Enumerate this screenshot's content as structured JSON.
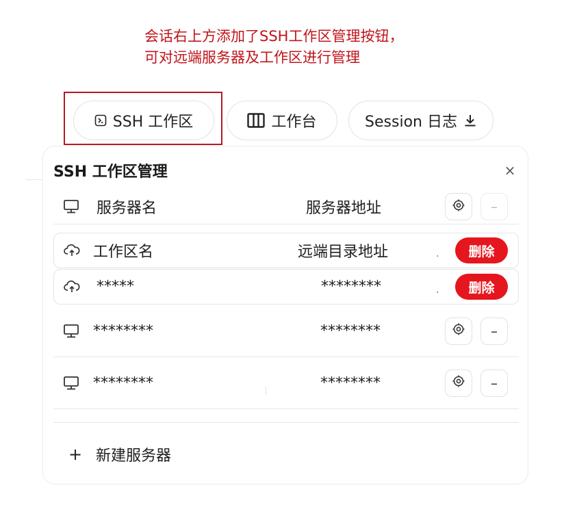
{
  "annotation": {
    "line1": "会话右上方添加了SSH工作区管理按钮，",
    "line2": "可对远端服务器及工作区进行管理"
  },
  "toolbar": {
    "ssh_label": "SSH 工作区",
    "workbench_label": "工作台",
    "session_label": "Session 日志"
  },
  "panel": {
    "title": "SSH 工作区管理",
    "close": "×",
    "header": {
      "name": "服务器名",
      "addr": "服务器地址",
      "settings_icon": "gear-icon",
      "remove": "–"
    },
    "workspaces": [
      {
        "name": "工作区名",
        "addr": "远端目录地址",
        "dot": ".",
        "delete": "删除"
      },
      {
        "name": "*****",
        "addr": "********",
        "dot": ".",
        "delete": "删除"
      }
    ],
    "servers": [
      {
        "name": "********",
        "addr": "********",
        "remove": "–"
      },
      {
        "name": "********",
        "addr": "********",
        "remove": "–"
      }
    ],
    "new_server": {
      "plus": "+",
      "label": "新建服务器"
    }
  },
  "colors": {
    "annotation": "#c0141a",
    "highlight_border": "#b3191f",
    "delete_bg": "#e5161d"
  }
}
